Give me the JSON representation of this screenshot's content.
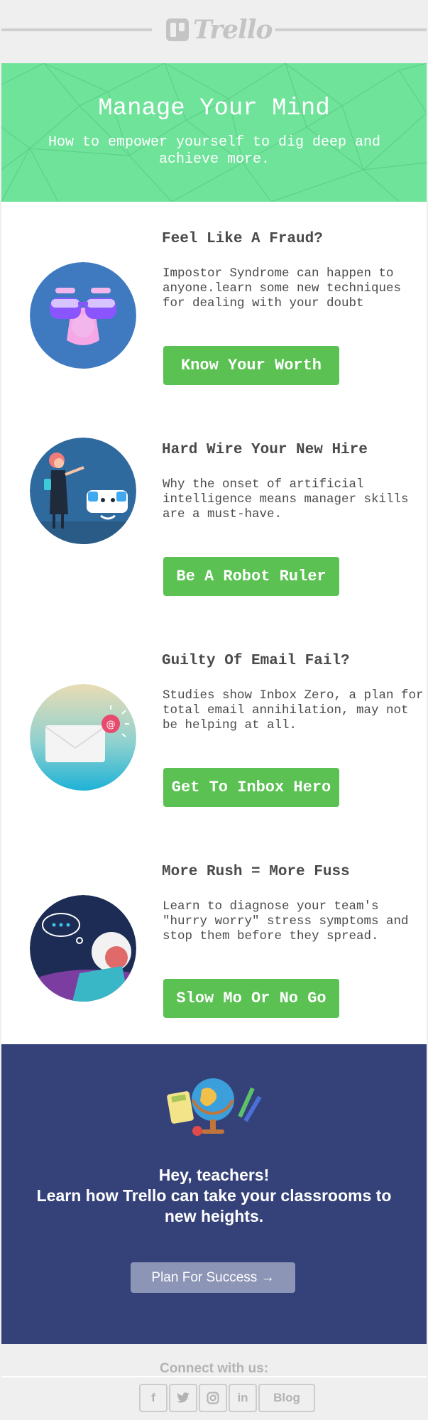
{
  "brand": {
    "logo_text": "Trello",
    "logo_icon": "trello-board-icon"
  },
  "hero": {
    "title": "Manage Your Mind",
    "subtitle": "How to empower yourself to dig deep and achieve more.",
    "background_color": "#6fe39a"
  },
  "articles": [
    {
      "title": "Feel Like A Fraud?",
      "body": "Impostor Syndrome can happen to anyone.learn some new techniques for dealing with your doubt",
      "button": "Know Your Worth",
      "illustration": "disguise-glasses-illustration"
    },
    {
      "title": "Hard Wire Your New Hire",
      "body": "Why the onset of artificial intelligence means manager skills are a must-have.",
      "button": "Be A Robot Ruler",
      "illustration": "woman-and-robot-illustration"
    },
    {
      "title": "Guilty Of Email Fail?",
      "body": "Studies show Inbox Zero, a plan for total email annihilation, may not be helping at all.",
      "button": "Get To Inbox Hero",
      "illustration": "envelope-notification-illustration"
    },
    {
      "title": "More Rush = More Fuss",
      "body": "Learn to diagnose your team's \"hurry worry\" stress symptoms and stop them before they spread.",
      "button": "Slow Mo Or No Go",
      "illustration": "worried-woman-illustration"
    }
  ],
  "teachers": {
    "line1": "Hey, teachers!",
    "line2": "Learn how Trello can take your classrooms to new heights.",
    "button": "Plan For Success →",
    "background_color": "#35427a",
    "illustration": "classroom-globe-illustration"
  },
  "footer": {
    "connect": "Connect with us:",
    "social": [
      {
        "icon": "facebook-icon",
        "glyph": "f"
      },
      {
        "icon": "twitter-icon",
        "glyph": ""
      },
      {
        "icon": "instagram-icon",
        "glyph": ""
      },
      {
        "icon": "linkedin-icon",
        "glyph": "in"
      }
    ],
    "blog": "Blog"
  },
  "colors": {
    "button_green": "#5ac152",
    "text_dark": "#4a4a4a",
    "footer_gray": "#b3b3b3"
  }
}
